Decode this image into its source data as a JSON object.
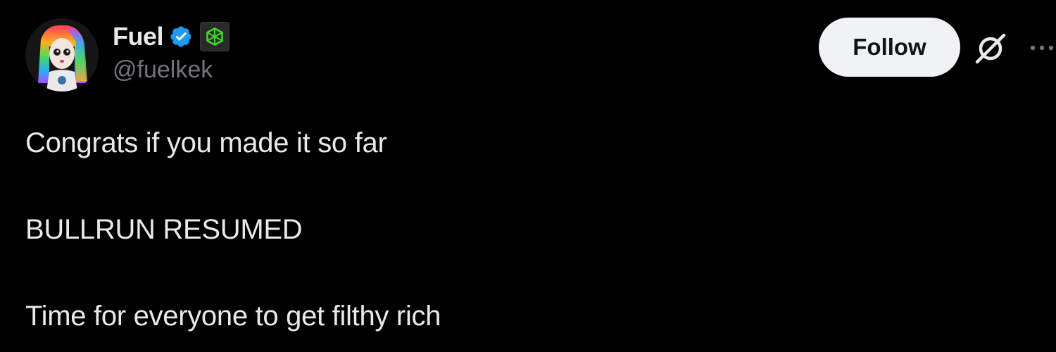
{
  "author": {
    "display_name": "Fuel",
    "handle": "@fuelkek",
    "verified": true,
    "verified_color": "#1d9bf0",
    "affiliate_badge_icon": "green-cube-icon",
    "affiliate_badge_color": "#3ddc27"
  },
  "actions": {
    "follow_label": "Follow",
    "grok_icon": "grok-icon",
    "more_icon": "more-icon"
  },
  "post": {
    "lines": [
      "Congrats if you made it so far",
      "",
      "BULLRUN RESUMED",
      "",
      "Time for everyone to get filthy rich"
    ]
  },
  "theme": {
    "background": "#000000",
    "text_primary": "#e7e9ea",
    "text_secondary": "#71767b",
    "follow_button_bg": "#eff3f4"
  }
}
